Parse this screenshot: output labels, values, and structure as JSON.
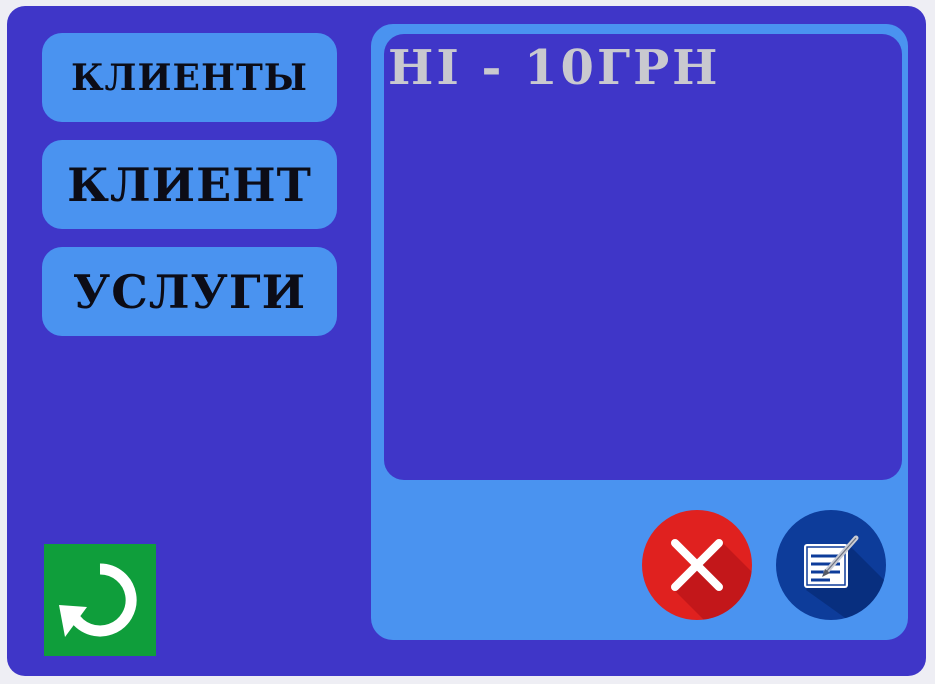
{
  "nav": {
    "clients_label": "КЛИЕНТЫ",
    "client_label": "КЛИЕНТ",
    "services_label": "УСЛУГИ"
  },
  "panel": {
    "content_text": "HI - 10ГРН"
  },
  "icons": {
    "refresh": "refresh-icon",
    "delete": "close-icon",
    "edit": "edit-document-icon"
  },
  "colors": {
    "window_bg": "#3f36c8",
    "button_bg": "#4a93f0",
    "refresh_bg": "#0f9e3b",
    "delete_bg": "#e0211f",
    "edit_bg": "#0d3c9a"
  }
}
